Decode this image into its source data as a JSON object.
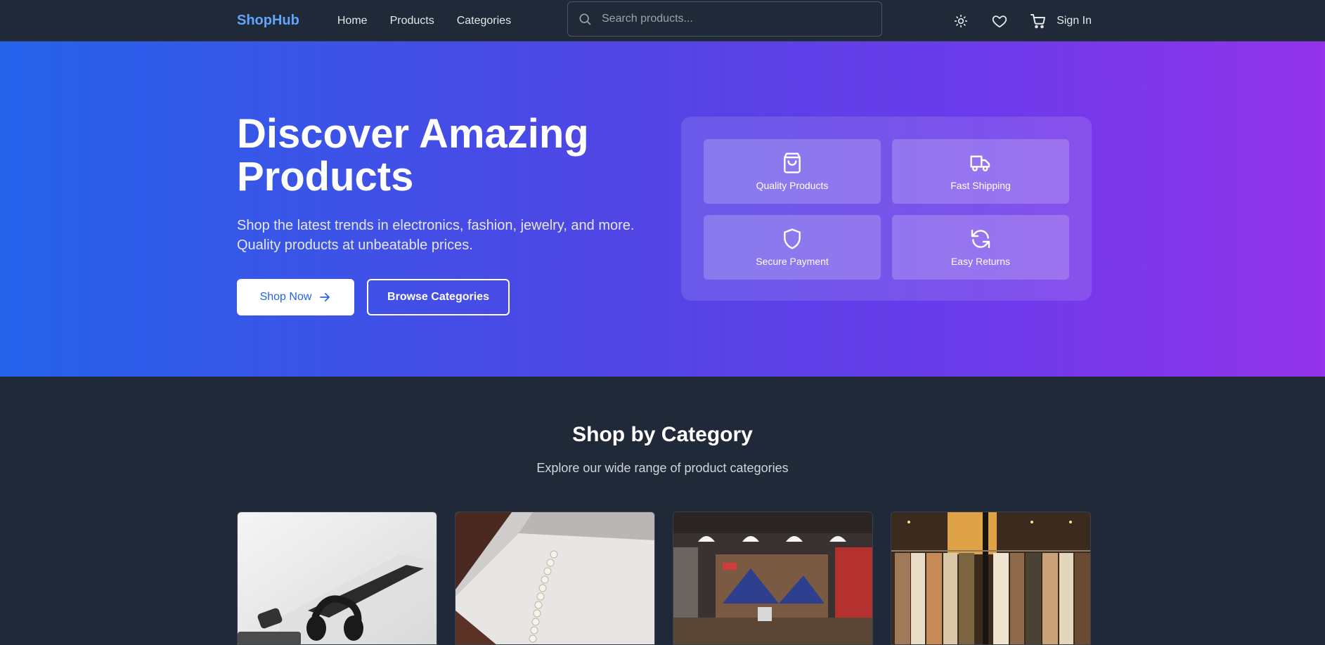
{
  "nav": {
    "logo": "ShopHub",
    "links": [
      "Home",
      "Products",
      "Categories"
    ],
    "search_placeholder": "Search products...",
    "sign_in": "Sign In",
    "icons": [
      "search-icon",
      "sun-icon",
      "heart-icon",
      "cart-icon"
    ]
  },
  "hero": {
    "title_line1": "Discover Amazing",
    "title_line2": "Products",
    "subtitle_line1": "Shop the latest trends in electronics, fashion, jewelry, and more.",
    "subtitle_line2": "Quality products at unbeatable prices.",
    "shop_now": "Shop Now",
    "browse_categories": "Browse Categories",
    "features": [
      {
        "label": "Quality Products",
        "icon": "shopping-bag-icon"
      },
      {
        "label": "Fast Shipping",
        "icon": "truck-icon"
      },
      {
        "label": "Secure Payment",
        "icon": "shield-icon"
      },
      {
        "label": "Easy Returns",
        "icon": "refresh-icon"
      }
    ],
    "gradient": [
      "#2563eb",
      "#4f46e5",
      "#9333ea"
    ]
  },
  "categories": {
    "title": "Shop by Category",
    "subtitle": "Explore our wide range of product categories",
    "cards": [
      "electronics-image",
      "jewelery-image",
      "mens-clothing-image",
      "womens-clothing-image"
    ]
  },
  "colors": {
    "background": "#1f2937",
    "accent": "#60a5fa",
    "primary": "#2563eb"
  }
}
